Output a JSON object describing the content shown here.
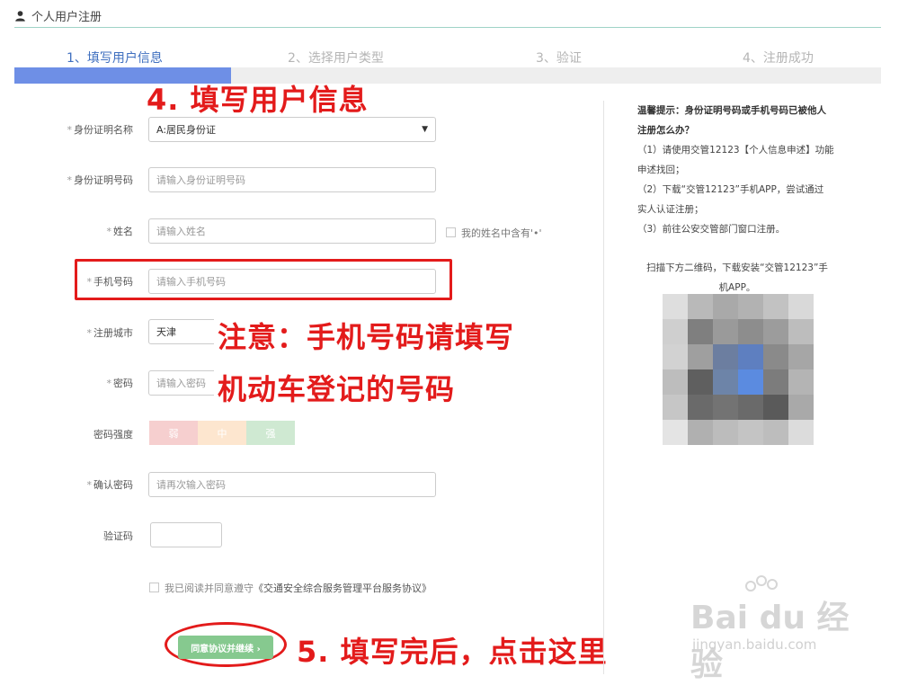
{
  "header": {
    "title": "个人用户注册",
    "icon": "user-icon"
  },
  "steps": [
    {
      "label": "1、填写用户信息",
      "active": true
    },
    {
      "label": "2、选择用户类型",
      "active": false
    },
    {
      "label": "3、验证",
      "active": false
    },
    {
      "label": "4、注册成功",
      "active": false
    }
  ],
  "form": {
    "id_type": {
      "label": "身份证明名称",
      "required": "*",
      "value": "A:居民身份证"
    },
    "id_number": {
      "label": "身份证明号码",
      "required": "*",
      "placeholder": "请输入身份证明号码"
    },
    "name": {
      "label": "姓名",
      "required": "*",
      "placeholder": "请输入姓名",
      "dot_checkbox_label": "我的姓名中含有'•'"
    },
    "phone": {
      "label": "手机号码",
      "required": "*",
      "placeholder": "请输入手机号码"
    },
    "city": {
      "label": "注册城市",
      "required": "*",
      "value": "天津"
    },
    "password": {
      "label": "密码",
      "required": "*",
      "placeholder": "请输入密码"
    },
    "strength": {
      "label": "密码强度",
      "weak": "弱",
      "medium": "中",
      "strong": "强"
    },
    "confirm": {
      "label": "确认密码",
      "required": "*",
      "placeholder": "请再次输入密码"
    },
    "captcha": {
      "label": "验证码"
    },
    "agreement": {
      "prefix": "我已阅读并同意遵守",
      "link": "《交通安全综合服务管理平台服务协议》"
    },
    "submit_label": "同意协议并继续 ›"
  },
  "annotations": {
    "step4": "4. 填写用户信息",
    "note_line1": "注意：手机号码请填写",
    "note_line2": "机动车登记的号码",
    "step5": "5. 填写完后，点击这里"
  },
  "tips": {
    "title_line1": "温馨提示：身份证明号码或手机号码已被他人",
    "title_line2": "注册怎么办？",
    "line1a": "（1）请使用交管12123【个人信息申述】功能",
    "line1b": "申述找回；",
    "line2a": "（2）下载“交管12123”手机APP，尝试通过",
    "line2b": "实人认证注册；",
    "line3": "（3）前往公安交管部门窗口注册。",
    "qr_line1": "扫描下方二维码，下载安装“交管12123”手",
    "qr_line2": "机APP。"
  },
  "watermark": {
    "brand": "Bai du 经验",
    "url": "jingyan.baidu.com"
  },
  "colors": {
    "accent": "#6e8fe6",
    "annotation": "#e31b1b",
    "submit": "#86c98f",
    "weak": "#f6cfcf",
    "medium": "#fde6cf",
    "strong": "#cfe9d2"
  }
}
